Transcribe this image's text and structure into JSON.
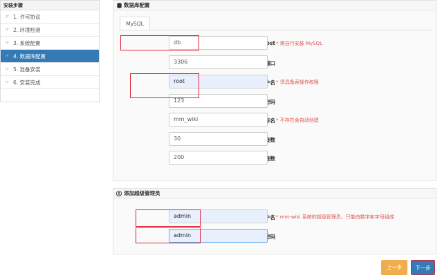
{
  "sidebar": {
    "title": "安装步骤",
    "items": [
      {
        "label": "1. 许可协议",
        "icon": "hand-right-icon"
      },
      {
        "label": "2. 环境检测",
        "icon": "hand-right-icon"
      },
      {
        "label": "3. 系统配置",
        "icon": "hand-right-icon"
      },
      {
        "label": "4. 数据库配置",
        "icon": "hand-right-icon",
        "active": true
      },
      {
        "label": "5. 准备安装",
        "icon": "hand-right-icon"
      },
      {
        "label": "6. 安装完成",
        "icon": "hand-right-icon"
      }
    ]
  },
  "db_panel": {
    "title": "数据库配置",
    "icon": "database-icon",
    "tab": "MySQL",
    "fields": {
      "host": {
        "label": "MySQL Host",
        "value": "db",
        "hint": "需自行安装 MySQL"
      },
      "port": {
        "label": "MySQL 端口",
        "value": "3306"
      },
      "user": {
        "label": "用户名",
        "value": "root",
        "hint": "须具备表操作权限"
      },
      "pass": {
        "label": "密码",
        "value": "123"
      },
      "dbname": {
        "label": "数据库名",
        "value": "mm_wiki",
        "hint": "不存在会自动创建"
      },
      "max_idle": {
        "label": "最大空闲连接数",
        "value": "30"
      },
      "max_conn": {
        "label": "最大连接数",
        "value": "200"
      }
    }
  },
  "admin_panel": {
    "title": "添加超级管理员",
    "icon": "user-icon",
    "fields": {
      "user": {
        "label": "用户名",
        "value": "admin",
        "hint": "mm-wiki 系统的超级管理员，只能由数字和字母组成"
      },
      "pass": {
        "label": "密码",
        "value": "admin"
      }
    }
  },
  "buttons": {
    "prev": "上一步",
    "next": "下一步"
  },
  "colors": {
    "accent": "#337ab7",
    "warning": "#f0ad4e",
    "required": "#d9534f",
    "highlight": "#e0202e"
  }
}
